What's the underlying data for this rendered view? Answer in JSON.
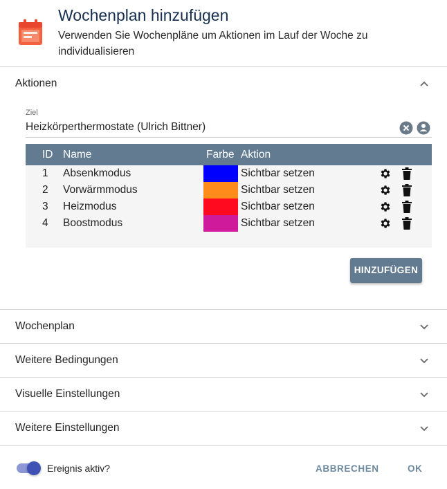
{
  "dialog": {
    "title": "Wochenplan hinzufügen",
    "subtitle": "Verwenden Sie Wochenpläne um Aktionen im Lauf der Woche zu individualisieren",
    "icon": "calendar-icon",
    "icon_color": "#e8472e"
  },
  "actions_section": {
    "label": "Aktionen",
    "expanded": true,
    "target": {
      "label": "Ziel",
      "value": "Heizkörperthermostate (Ulrich Bittner)"
    },
    "table": {
      "header_color": "#627b91",
      "columns": [
        "ID",
        "Name",
        "Farbe",
        "Aktion"
      ],
      "rows": [
        {
          "id": "1",
          "name": "Absenkmodus",
          "color": "#0000ff",
          "action": "Sichtbar setzen"
        },
        {
          "id": "2",
          "name": "Vorwärmmodus",
          "color": "#ff8c1a",
          "action": "Sichtbar setzen"
        },
        {
          "id": "3",
          "name": "Heizmodus",
          "color": "#ff0a1e",
          "action": "Sichtbar setzen"
        },
        {
          "id": "4",
          "name": "Boostmodus",
          "color": "#d01a9c",
          "action": "Sichtbar setzen"
        }
      ]
    },
    "add_button": "HINZUFÜGEN"
  },
  "sections": [
    {
      "label": "Wochenplan"
    },
    {
      "label": "Weitere Bedingungen"
    },
    {
      "label": "Visuelle Einstellungen"
    },
    {
      "label": "Weitere Einstellungen"
    }
  ],
  "footer": {
    "toggle_label": "Ereignis aktiv?",
    "toggle_on": true,
    "cancel_label": "ABBRECHEN",
    "ok_label": "OK"
  }
}
